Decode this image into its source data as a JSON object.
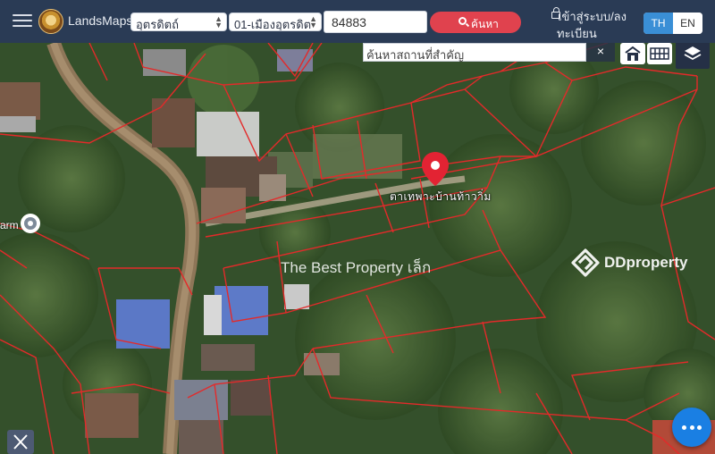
{
  "header": {
    "brand": "LandsMaps",
    "province_select": "อุตรดิตถ์",
    "district_select": "01-เมืองอุตรดิต",
    "parcel_number": "84883",
    "search_button": "ค้นหา",
    "login_line1": "เข้าสู่ระบบ/ลง",
    "login_line2": "ทะเบียน",
    "lang_th": "TH",
    "lang_en": "EN",
    "active_lang": "TH"
  },
  "map": {
    "place_search_placeholder": "ค้นหาสถานที่สำคัญ",
    "close_label": "×",
    "pin_label": "ตาเทพาะบ้านท้าวาิ่ม",
    "poi_label": "arm",
    "watermark": "The Best Property เล็ก",
    "dd_brand": "DDproperty",
    "fab_label": "•••"
  },
  "colors": {
    "topbar": "#2a3b55",
    "search_button": "#e0424e",
    "active_lang": "#3a8fd6",
    "parcel_lines": "#e32a2a",
    "pin": "#e32333",
    "fab": "#1a7fe3"
  },
  "icons": [
    "hamburger-icon",
    "search-icon",
    "lock-icon",
    "close-icon",
    "home-icon",
    "grid-icon",
    "layers-icon",
    "map-pin-icon",
    "poi-icon",
    "ddproperty-logo-icon",
    "more-icon",
    "measure-icon"
  ]
}
